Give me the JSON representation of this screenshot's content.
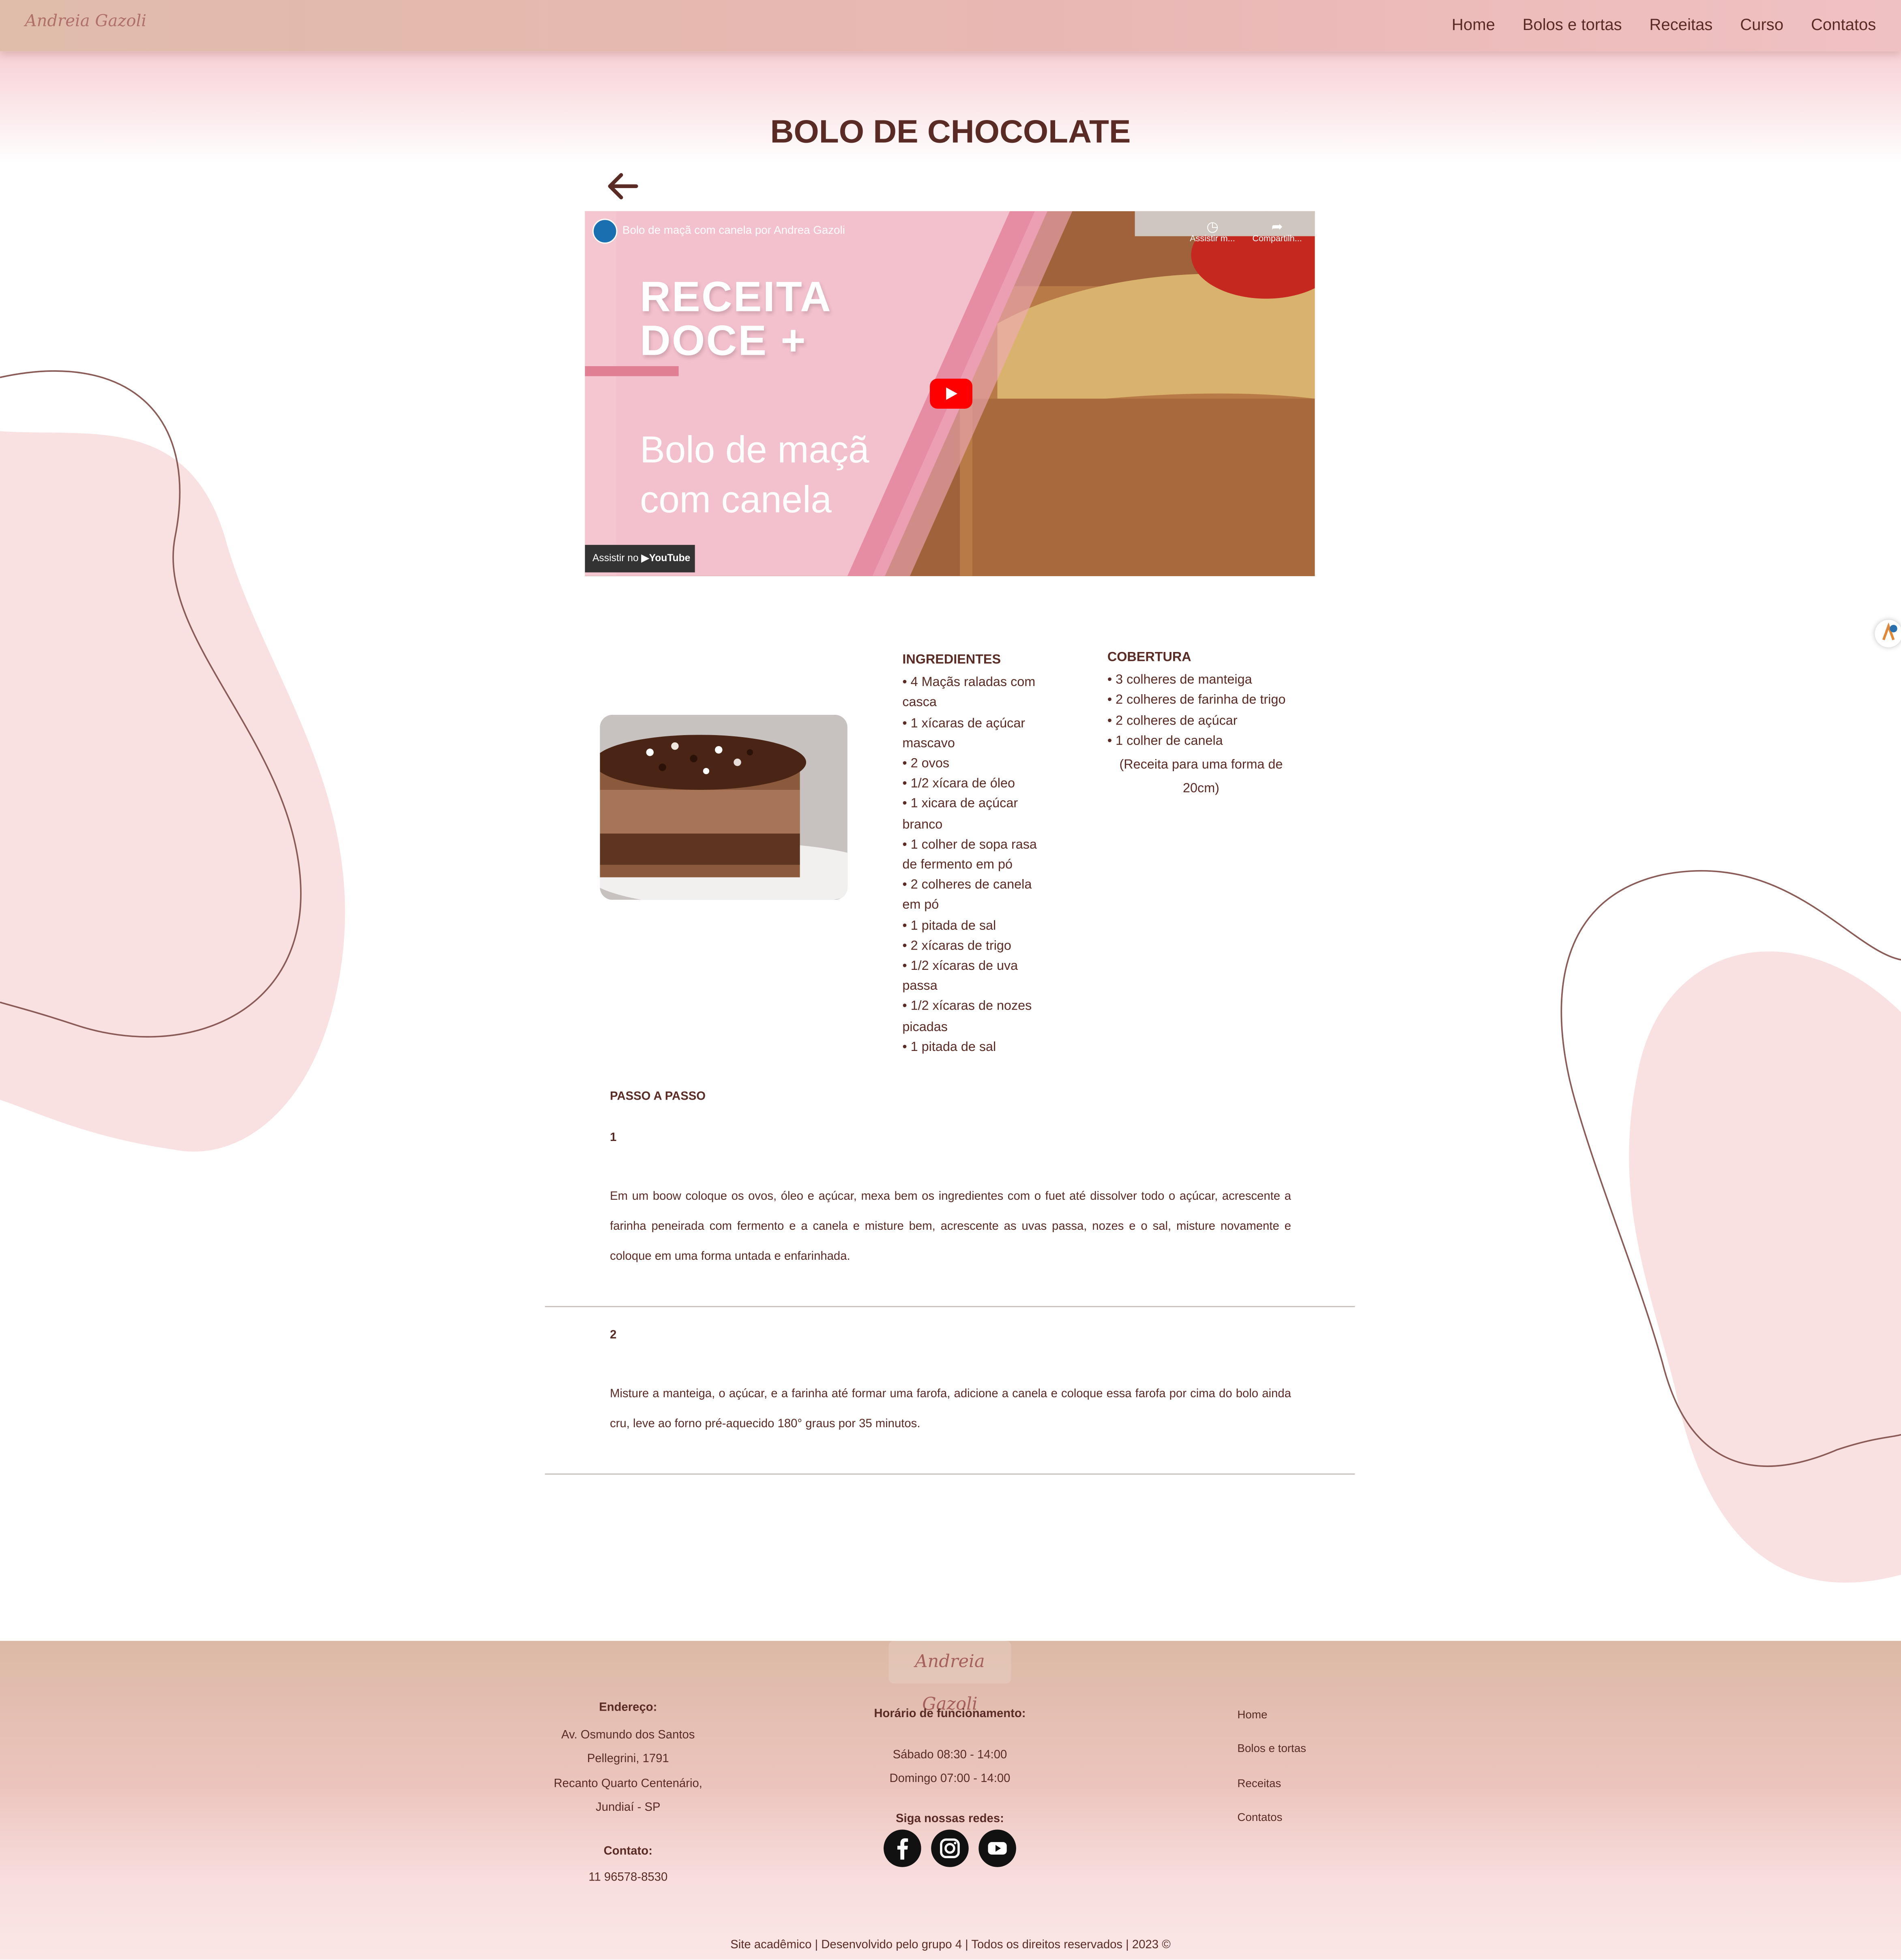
{
  "header": {
    "logo_text": "Andreia Gazoli",
    "nav": [
      "Home",
      "Bolos e tortas",
      "Receitas",
      "Curso",
      "Contatos"
    ]
  },
  "page": {
    "title": "BOLO DE CHOCOLATE"
  },
  "video": {
    "title": "Bolo de maçã com canela por Andrea Gazoli",
    "watch_later": "Assistir m...",
    "share": "Compartilh...",
    "heading_line1": "RECEITA",
    "heading_line2": "DOCE +",
    "subtitle_line1": "Bolo de maçã",
    "subtitle_line2": "com canela",
    "watch_on": "Assistir no",
    "platform": "YouTube"
  },
  "ingredients": {
    "title": "INGREDIENTES",
    "items": [
      "• 4 Maçãs raladas com casca",
      "• 1 xícaras de açúcar mascavo",
      "• 2 ovos",
      "• 1/2 xícara de óleo",
      "• 1 xicara de açúcar branco",
      "• 1 colher de sopa rasa de fermento em pó",
      "• 2 colheres de canela em pó",
      "• 1 pitada de sal",
      "• 2 xícaras de trigo",
      "• 1/2 xícaras de uva passa",
      "• 1/2 xícaras de nozes picadas",
      "• 1 pitada de sal"
    ]
  },
  "topping": {
    "title": "COBERTURA",
    "items": [
      "• 3 colheres de manteiga",
      "• 2 colheres de farinha de trigo",
      "• 2 colheres de açúcar",
      "• 1 colher de canela"
    ],
    "note": "(Receita para uma forma de 20cm)"
  },
  "steps": {
    "title": "PASSO A PASSO",
    "items": [
      {
        "number": "1",
        "text": "Em um boow coloque os ovos, óleo e açúcar, mexa bem os ingredientes com o fuet até dissolver todo o açúcar, acrescente a farinha peneirada com fermento e a canela e misture bem, acrescente as uvas passa, nozes e o sal, misture novamente e coloque em uma forma untada e enfarinhada."
      },
      {
        "number": "2",
        "text": "Misture a manteiga, o açúcar, e a farinha até formar uma farofa, adicione a canela e coloque essa farofa por cima do bolo ainda cru, leve ao forno pré-aquecido 180° graus por 35 minutos."
      }
    ]
  },
  "footer": {
    "logo_text": "Andreia Gazoli",
    "address_label": "Endereço:",
    "address_lines": [
      "Av. Osmundo dos Santos",
      "Pellegrini, 1791",
      "Recanto Quarto Centenário,",
      "Jundiaí - SP"
    ],
    "contact_label": "Contato:",
    "phone": "11 96578-8530",
    "hours_label": "Horário de funcionamento:",
    "hours_lines": [
      "Sábado 08:30 - 14:00",
      "Domingo 07:00 - 14:00"
    ],
    "social_label": "Siga nossas redes:",
    "links": [
      "Home",
      "Bolos e tortas",
      "Receitas",
      "Contatos"
    ],
    "copyright": "Site acadêmico | Desenvolvido pelo grupo 4 | Todos os direitos reservados | 2023 ©"
  },
  "colors": {
    "brand_brown": "#5a2b25",
    "blob_pink": "#f9e0e1",
    "header_pink": "#e9b7b3",
    "footer_tan": "#dcb9a6"
  }
}
